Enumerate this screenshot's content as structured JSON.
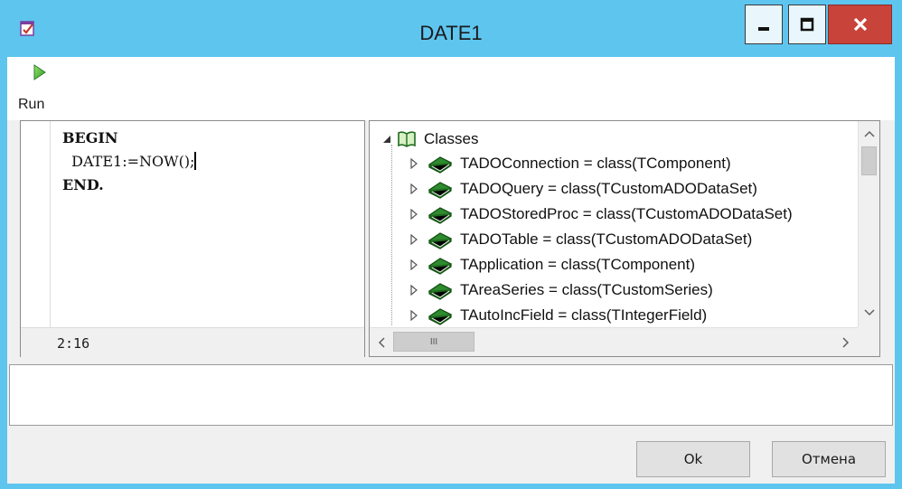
{
  "window": {
    "title": "DATE1",
    "icon": "checklist-app-icon",
    "controls": {
      "minimize": "minimize-icon",
      "maximize": "maximize-icon",
      "close": "close-icon"
    }
  },
  "toolbar": {
    "run_label": "Run",
    "run_icon": "play-icon"
  },
  "editor": {
    "lines": [
      {
        "text": "BEGIN",
        "bold": true
      },
      {
        "text": "  DATE1:=NOW();",
        "bold": false
      },
      {
        "text": "END.",
        "bold": true
      }
    ],
    "cursor_position": "2:16"
  },
  "tree": {
    "root_label": "Classes",
    "root_icon": "book-open-icon",
    "items": [
      {
        "label": "TADOConnection = class(TComponent)",
        "icon": "class-book-icon"
      },
      {
        "label": "TADOQuery = class(TCustomADODataSet)",
        "icon": "class-book-icon"
      },
      {
        "label": "TADOStoredProc = class(TCustomADODataSet)",
        "icon": "class-book-icon"
      },
      {
        "label": "TADOTable = class(TCustomADODataSet)",
        "icon": "class-book-icon"
      },
      {
        "label": "TApplication = class(TComponent)",
        "icon": "class-book-icon"
      },
      {
        "label": "TAreaSeries = class(TCustomSeries)",
        "icon": "class-book-icon"
      },
      {
        "label": "TAutoIncField = class(TIntegerField)",
        "icon": "class-book-icon"
      }
    ],
    "hscroll_thumb_glyph": "III"
  },
  "buttons": {
    "ok": "Ok",
    "cancel": "Отмена"
  },
  "colors": {
    "titlebar": "#5ec5ef",
    "close": "#c8433a",
    "book_green": "#2e8b2e"
  }
}
